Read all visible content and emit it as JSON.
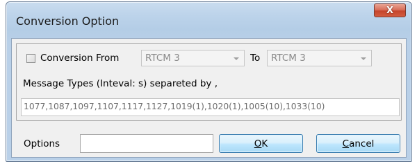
{
  "window": {
    "title": "Conversion Option",
    "close_glyph": "X"
  },
  "conversion": {
    "checkbox_label": "Conversion From",
    "checked": false,
    "from_value": "RTCM 3",
    "to_label": "To",
    "to_value": "RTCM 3"
  },
  "message_types": {
    "label": "Message Types  (Inteval: s) separeted by ,",
    "value": "1077,1087,1097,1107,1117,1127,1019(1),1020(1),1005(10),1033(10)"
  },
  "footer": {
    "options_label": "Options",
    "options_value": "",
    "ok_mnemonic": "O",
    "ok_rest": "K",
    "cancel_mnemonic": "C",
    "cancel_rest": "ancel"
  },
  "colors": {
    "title_bar": "#bcd3ea",
    "close_button": "#c5452c",
    "dialog_body": "#f0f0f0",
    "default_button": "#bee6fd"
  },
  "icons": {
    "close": "close-icon",
    "dropdown": "chevron-down-icon"
  }
}
